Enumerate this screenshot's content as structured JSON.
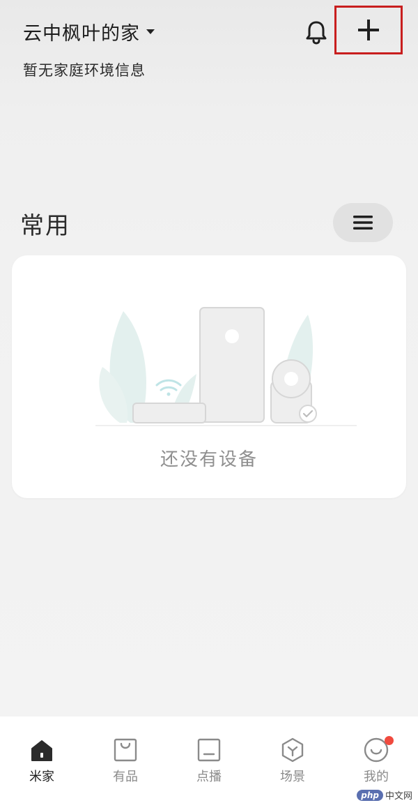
{
  "header": {
    "home_name": "云中枫叶的家",
    "env_info": "暂无家庭环境信息"
  },
  "section": {
    "title": "常用"
  },
  "empty_state": {
    "text": "还没有设备"
  },
  "tabbar": {
    "tabs": [
      {
        "label": "米家",
        "icon": "home-icon",
        "active": true
      },
      {
        "label": "有品",
        "icon": "shopping-bag-icon",
        "active": false
      },
      {
        "label": "点播",
        "icon": "media-icon",
        "active": false
      },
      {
        "label": "场景",
        "icon": "scene-cube-icon",
        "active": false
      },
      {
        "label": "我的",
        "icon": "profile-smile-icon",
        "active": false,
        "badge": true
      }
    ]
  },
  "watermark": {
    "brand": "php",
    "text": "中文网"
  },
  "colors": {
    "highlight_border": "#c81e1e",
    "badge": "#f04a3e",
    "active_tab": "#1f1f1f",
    "inactive_tab": "#8a8a8a"
  }
}
